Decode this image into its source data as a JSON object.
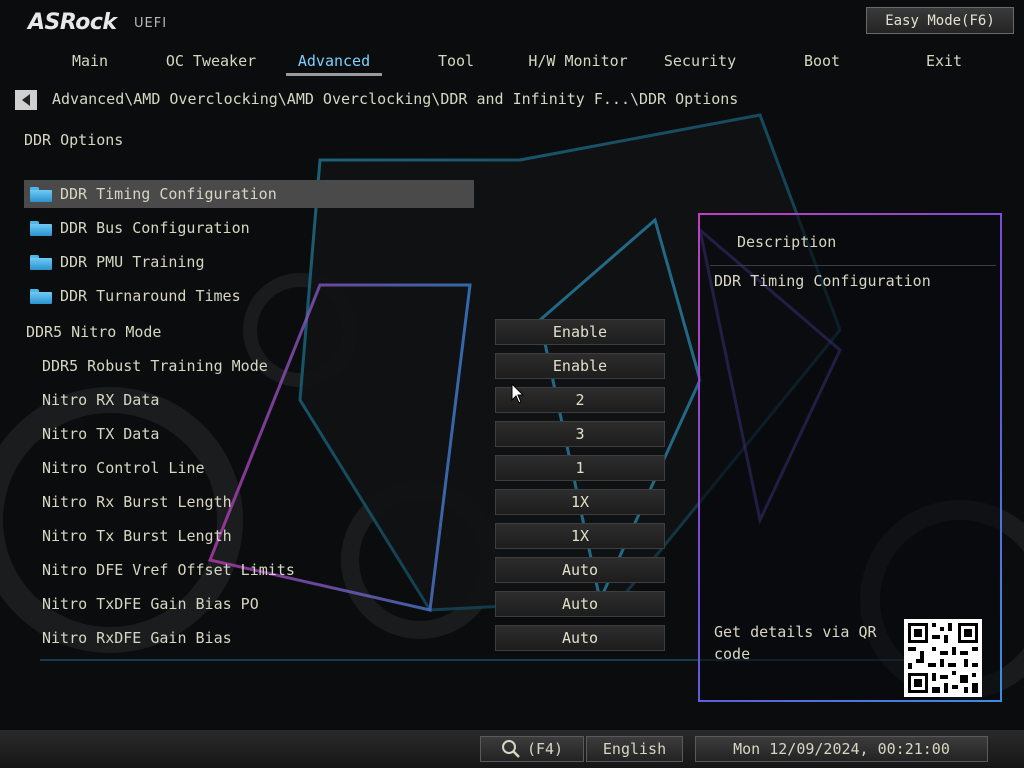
{
  "header": {
    "logo_text": "ASRock",
    "logo_sub": "UEFI",
    "easy_mode_label": "Easy Mode(F6)"
  },
  "tabs": [
    {
      "label": "Main"
    },
    {
      "label": "OC Tweaker"
    },
    {
      "label": "Advanced",
      "active": true
    },
    {
      "label": "Tool"
    },
    {
      "label": "H/W Monitor"
    },
    {
      "label": "Security"
    },
    {
      "label": "Boot"
    },
    {
      "label": "Exit"
    }
  ],
  "breadcrumb": "Advanced\\AMD Overclocking\\AMD Overclocking\\DDR and Infinity F...\\DDR Options",
  "page_title": "DDR Options",
  "submenus": [
    {
      "label": "DDR Timing Configuration"
    },
    {
      "label": "DDR Bus Configuration"
    },
    {
      "label": "DDR PMU Training"
    },
    {
      "label": "DDR Turnaround Times"
    }
  ],
  "settings": [
    {
      "label": "DDR5 Nitro Mode",
      "value": "Enable"
    },
    {
      "label": "DDR5 Robust Training Mode",
      "value": "Enable"
    },
    {
      "label": "Nitro RX Data",
      "value": "2"
    },
    {
      "label": "Nitro TX Data",
      "value": "3"
    },
    {
      "label": "Nitro Control Line",
      "value": "1"
    },
    {
      "label": "Nitro Rx Burst Length",
      "value": "1X"
    },
    {
      "label": "Nitro Tx Burst Length",
      "value": "1X"
    },
    {
      "label": "Nitro DFE Vref Offset Limits",
      "value": "Auto"
    },
    {
      "label": "Nitro TxDFE Gain Bias PO",
      "value": "Auto"
    },
    {
      "label": "Nitro RxDFE Gain Bias",
      "value": "Auto"
    }
  ],
  "description": {
    "title": "Description",
    "text": "DDR Timing Configuration",
    "qr_text": "Get details via QR code"
  },
  "footer": {
    "search_label": "(F4)",
    "language": "English",
    "datetime": "Mon 12/09/2024, 00:21:00"
  },
  "colors": {
    "accent_tab": "#7bd1ff",
    "text": "#d6d6c2",
    "selected_row": "#4a4a4a",
    "folder_icon": "#4fb6e8"
  }
}
